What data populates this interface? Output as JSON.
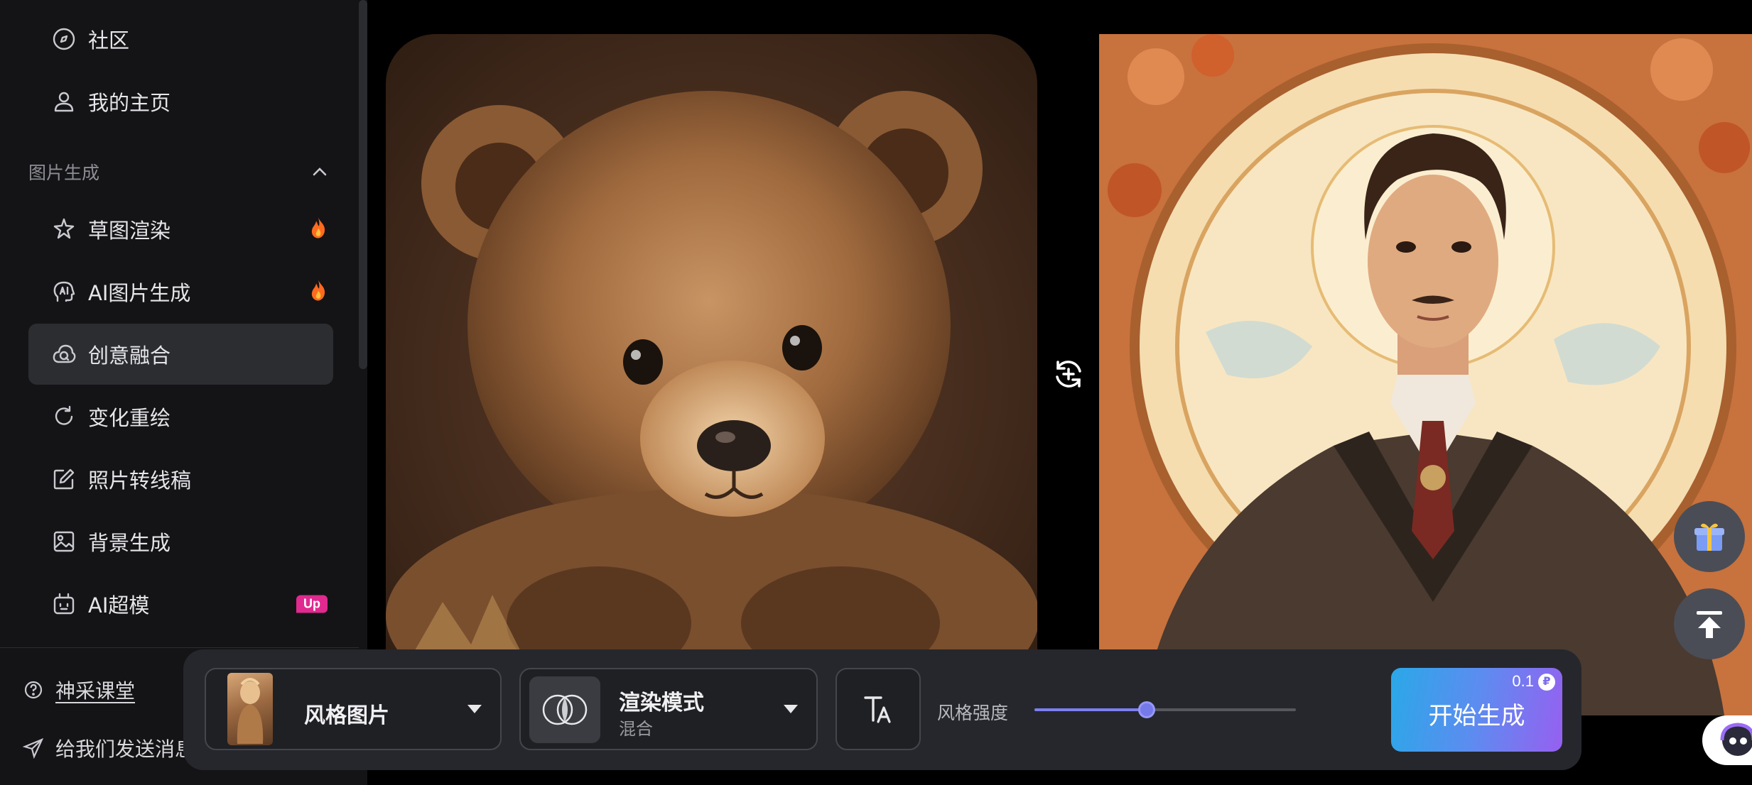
{
  "sidebar": {
    "top_items": [
      {
        "label": "社区",
        "icon": "compass-icon"
      },
      {
        "label": "我的主页",
        "icon": "user-icon"
      }
    ],
    "section_title": "图片生成",
    "items": [
      {
        "label": "草图渲染",
        "icon": "sketch-icon",
        "badge": "hot"
      },
      {
        "label": "AI图片生成",
        "icon": "ai-head-icon",
        "badge": "hot"
      },
      {
        "label": "创意融合",
        "icon": "blend-icon",
        "active": true
      },
      {
        "label": "变化重绘",
        "icon": "refresh-icon"
      },
      {
        "label": "照片转线稿",
        "icon": "edit-icon"
      },
      {
        "label": "背景生成",
        "icon": "image-icon"
      },
      {
        "label": "AI超模",
        "icon": "robot-icon",
        "badge": "Up"
      }
    ],
    "bottom_links": [
      {
        "label": "神采课堂",
        "icon": "help-circle-icon"
      },
      {
        "label": "给我们发送消息",
        "icon": "send-icon"
      }
    ]
  },
  "canvas": {
    "left_image": "bear-cub-photo",
    "right_image": "art-nouveau-portrait",
    "swap_icon": "swap-images-icon"
  },
  "floating": {
    "gift_icon": "gift-icon",
    "top_icon": "back-to-top-icon"
  },
  "toolbar": {
    "style_image_label": "风格图片",
    "render_mode_label": "渲染模式",
    "render_mode_value": "混合",
    "text_mode_icon": "text-size-icon",
    "strength_label": "风格强度",
    "strength_value": 0.43,
    "generate_label": "开始生成",
    "generate_cost": "0.1"
  },
  "colors": {
    "accent": "#7679ea",
    "badge_pink": "#e02a8f",
    "active_bg": "#2c2d31"
  }
}
